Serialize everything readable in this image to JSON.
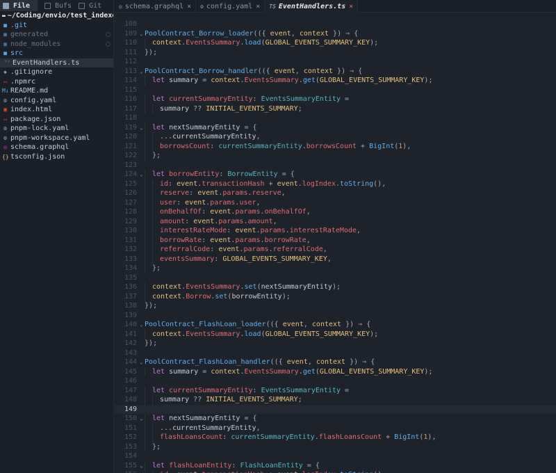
{
  "sidebar": {
    "tabs": [
      {
        "label": "File",
        "icon": "folder-icon"
      },
      {
        "label": "Bufs",
        "icon": "buffers-icon"
      },
      {
        "label": "Git",
        "icon": "git-icon"
      }
    ],
    "root": "~/Coding/envio/test_indexer",
    "items": [
      {
        "label": ".git",
        "icon": "folder-icon",
        "kind": "folder"
      },
      {
        "label": "generated",
        "icon": "folder-icon",
        "kind": "folder-dim"
      },
      {
        "label": "node_modules",
        "icon": "folder-icon",
        "kind": "folder-dim"
      },
      {
        "label": "src",
        "icon": "folder-icon",
        "kind": "folder"
      },
      {
        "label": "EventHandlers.ts",
        "icon": "typescript-icon",
        "kind": "file-selected"
      },
      {
        "label": ".gitignore",
        "icon": "git-icon",
        "kind": "file"
      },
      {
        "label": ".npmrc",
        "icon": "npm-icon",
        "kind": "file"
      },
      {
        "label": "README.md",
        "icon": "markdown-icon",
        "kind": "file"
      },
      {
        "label": "config.yaml",
        "icon": "gear-icon",
        "kind": "file"
      },
      {
        "label": "index.html",
        "icon": "html-icon",
        "kind": "file"
      },
      {
        "label": "package.json",
        "icon": "npm-icon",
        "kind": "file"
      },
      {
        "label": "pnpm-lock.yaml",
        "icon": "gear-icon",
        "kind": "file"
      },
      {
        "label": "pnpm-workspace.yaml",
        "icon": "gear-icon",
        "kind": "file"
      },
      {
        "label": "schema.graphql",
        "icon": "graphql-icon",
        "kind": "file"
      },
      {
        "label": "tsconfig.json",
        "icon": "json-icon",
        "kind": "file"
      }
    ]
  },
  "tabs": [
    {
      "label": "schema.graphql",
      "icon": "graphql-icon",
      "close": "×",
      "active": false
    },
    {
      "label": "config.yaml",
      "icon": "gear-icon",
      "close": "×",
      "active": false
    },
    {
      "label": "EventHandlers.ts",
      "icon": "TS",
      "close": "×",
      "active": true
    }
  ],
  "editor": {
    "current_line": 149,
    "lines": [
      {
        "n": "108",
        "fold": "",
        "code": ""
      },
      {
        "n": "109",
        "fold": "v",
        "code": "PoolContract_Borrow_loader(({ event, context }) ⇒ {"
      },
      {
        "n": "110",
        "fold": "",
        "code": "  context.EventsSummary.load(GLOBAL_EVENTS_SUMMARY_KEY);"
      },
      {
        "n": "111",
        "fold": "",
        "code": "});"
      },
      {
        "n": "112",
        "fold": "",
        "code": ""
      },
      {
        "n": "113",
        "fold": "v",
        "code": "PoolContract_Borrow_handler(({ event, context }) ⇒ {"
      },
      {
        "n": "114",
        "fold": "",
        "code": "  let summary = context.EventsSummary.get(GLOBAL_EVENTS_SUMMARY_KEY);"
      },
      {
        "n": "115",
        "fold": "",
        "code": ""
      },
      {
        "n": "116",
        "fold": "",
        "code": "  let currentSummaryEntity: EventsSummaryEntity ="
      },
      {
        "n": "117",
        "fold": "",
        "code": "    summary ?? INITIAL_EVENTS_SUMMARY;"
      },
      {
        "n": "118",
        "fold": "",
        "code": ""
      },
      {
        "n": "119",
        "fold": "v",
        "code": "  let nextSummaryEntity = {"
      },
      {
        "n": "120",
        "fold": "",
        "code": "    ...currentSummaryEntity,"
      },
      {
        "n": "121",
        "fold": "",
        "code": "    borrowsCount: currentSummaryEntity.borrowsCount + BigInt(1),"
      },
      {
        "n": "122",
        "fold": "",
        "code": "  };"
      },
      {
        "n": "123",
        "fold": "",
        "code": ""
      },
      {
        "n": "124",
        "fold": "v",
        "code": "  let borrowEntity: BorrowEntity = {"
      },
      {
        "n": "125",
        "fold": "",
        "code": "    id: event.transactionHash + event.logIndex.toString(),"
      },
      {
        "n": "126",
        "fold": "",
        "code": "    reserve: event.params.reserve,"
      },
      {
        "n": "127",
        "fold": "",
        "code": "    user: event.params.user,"
      },
      {
        "n": "128",
        "fold": "",
        "code": "    onBehalfOf: event.params.onBehalfOf,"
      },
      {
        "n": "129",
        "fold": "",
        "code": "    amount: event.params.amount,"
      },
      {
        "n": "130",
        "fold": "",
        "code": "    interestRateMode: event.params.interestRateMode,"
      },
      {
        "n": "131",
        "fold": "",
        "code": "    borrowRate: event.params.borrowRate,"
      },
      {
        "n": "132",
        "fold": "",
        "code": "    referralCode: event.params.referralCode,"
      },
      {
        "n": "133",
        "fold": "",
        "code": "    eventsSummary: GLOBAL_EVENTS_SUMMARY_KEY,"
      },
      {
        "n": "134",
        "fold": "",
        "code": "  };"
      },
      {
        "n": "135",
        "fold": "",
        "code": ""
      },
      {
        "n": "136",
        "fold": "",
        "code": "  context.EventsSummary.set(nextSummaryEntity);"
      },
      {
        "n": "137",
        "fold": "",
        "code": "  context.Borrow.set(borrowEntity);"
      },
      {
        "n": "138",
        "fold": "",
        "code": "});"
      },
      {
        "n": "139",
        "fold": "",
        "code": ""
      },
      {
        "n": "140",
        "fold": "v",
        "code": "PoolContract_FlashLoan_loader(({ event, context }) ⇒ {"
      },
      {
        "n": "141",
        "fold": "",
        "code": "  context.EventsSummary.load(GLOBAL_EVENTS_SUMMARY_KEY);"
      },
      {
        "n": "142",
        "fold": "",
        "code": "});"
      },
      {
        "n": "143",
        "fold": "",
        "code": ""
      },
      {
        "n": "144",
        "fold": "v",
        "code": "PoolContract_FlashLoan_handler(({ event, context }) ⇒ {"
      },
      {
        "n": "145",
        "fold": "",
        "code": "  let summary = context.EventsSummary.get(GLOBAL_EVENTS_SUMMARY_KEY);"
      },
      {
        "n": "146",
        "fold": "",
        "code": ""
      },
      {
        "n": "147",
        "fold": "",
        "code": "  let currentSummaryEntity: EventsSummaryEntity ="
      },
      {
        "n": "148",
        "fold": "",
        "code": "    summary ?? INITIAL_EVENTS_SUMMARY;"
      },
      {
        "n": "149",
        "fold": "",
        "code": ""
      },
      {
        "n": "150",
        "fold": "v",
        "code": "  let nextSummaryEntity = {"
      },
      {
        "n": "151",
        "fold": "",
        "code": "    ...currentSummaryEntity,"
      },
      {
        "n": "152",
        "fold": "",
        "code": "    flashLoansCount: currentSummaryEntity.flashLoansCount + BigInt(1),"
      },
      {
        "n": "153",
        "fold": "",
        "code": "  };"
      },
      {
        "n": "154",
        "fold": "",
        "code": ""
      },
      {
        "n": "155",
        "fold": "v",
        "code": "  let flashLoanEntity: FlashLoanEntity = {"
      },
      {
        "n": "156",
        "fold": "",
        "code": "    id: event.transactionHash + event.logIndex.toString(),"
      }
    ]
  },
  "colors": {
    "background": "#1e222b",
    "function": "#61afef",
    "keyword": "#c678dd",
    "property": "#e06c75",
    "constant": "#e5c07b",
    "type": "#56b6c2"
  }
}
